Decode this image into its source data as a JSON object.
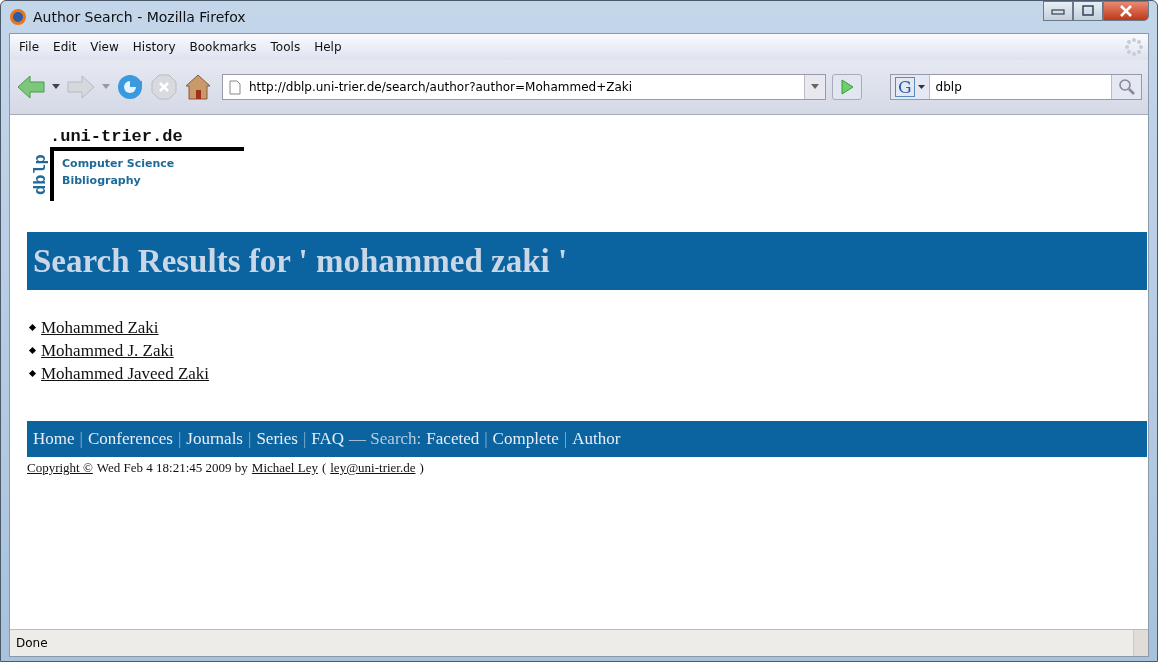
{
  "window": {
    "title": "Author Search - Mozilla Firefox"
  },
  "menu": [
    "File",
    "Edit",
    "View",
    "History",
    "Bookmarks",
    "Tools",
    "Help"
  ],
  "toolbar": {
    "url": "http://dblp.uni-trier.de/search/author?author=Mohammed+Zaki",
    "search_value": "dblp",
    "search_engine": "G"
  },
  "logo": {
    "vertical": "dblp",
    "domain": ".uni-trier.de",
    "line1": "Computer Science",
    "line2": "Bibliography"
  },
  "heading": "Search Results for ' mohammed zaki '",
  "results": [
    "Mohammed Zaki",
    "Mohammed J. Zaki",
    "Mohammed Javeed Zaki"
  ],
  "footer_nav": [
    {
      "kind": "link",
      "text": "Home"
    },
    {
      "kind": "separator",
      "text": "|"
    },
    {
      "kind": "link",
      "text": "Conferences"
    },
    {
      "kind": "separator",
      "text": "|"
    },
    {
      "kind": "link",
      "text": "Journals"
    },
    {
      "kind": "separator",
      "text": "|"
    },
    {
      "kind": "link",
      "text": "Series"
    },
    {
      "kind": "separator",
      "text": "|"
    },
    {
      "kind": "link",
      "text": "FAQ"
    },
    {
      "kind": "label",
      "text": "— Search:"
    },
    {
      "kind": "link",
      "text": "Faceted"
    },
    {
      "kind": "separator",
      "text": "|"
    },
    {
      "kind": "link",
      "text": "Complete"
    },
    {
      "kind": "separator",
      "text": "|"
    },
    {
      "kind": "link",
      "text": "Author"
    }
  ],
  "copyright": [
    {
      "kind": "link",
      "text": "Copyright ©"
    },
    {
      "kind": "text",
      "text": "Wed Feb 4 18:21:45 2009 by"
    },
    {
      "kind": "link",
      "text": "Michael Ley"
    },
    {
      "kind": "text",
      "text": "("
    },
    {
      "kind": "link",
      "text": "ley@uni-trier.de"
    },
    {
      "kind": "text",
      "text": ")"
    }
  ],
  "status_bar": {
    "text": "Done"
  }
}
